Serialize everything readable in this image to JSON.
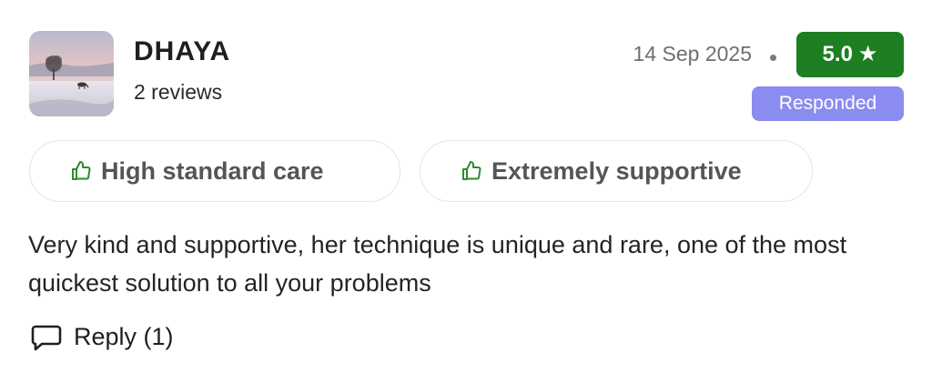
{
  "reviewer": {
    "name": "DHAYA",
    "review_count": "2 reviews"
  },
  "review": {
    "date": "14 Sep 2025",
    "rating": "5.0",
    "rating_icon": "star-icon",
    "status_badge": "Responded",
    "tags": [
      {
        "label": "High standard care",
        "icon": "thumbs-up-icon"
      },
      {
        "label": "Extremely supportive",
        "icon": "thumbs-up-icon"
      }
    ],
    "text": "Very kind and supportive, her technique is unique and rare, one of the most quickest solution to all your problems"
  },
  "actions": {
    "reply_label": "Reply (1)",
    "reply_icon": "comment-icon"
  },
  "colors": {
    "rating_badge_bg": "#1e7e22",
    "responded_badge_bg": "#8a8cf0",
    "thumbs_icon": "#2e8b2e"
  }
}
